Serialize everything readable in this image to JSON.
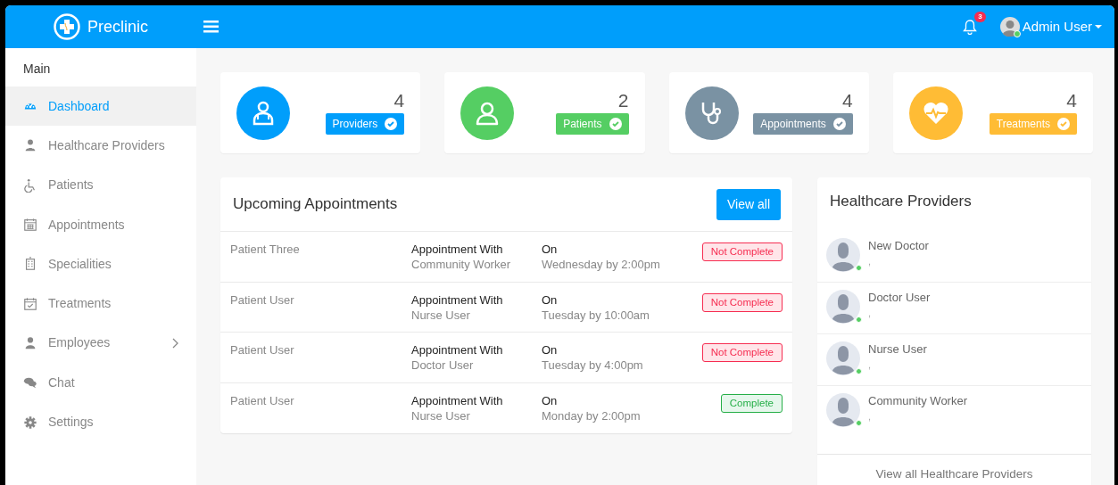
{
  "header": {
    "brand": "Preclinic",
    "notifications": {
      "count": "3"
    },
    "user": {
      "name": "Admin User",
      "online": true
    }
  },
  "sidebar": {
    "heading": "Main",
    "items": [
      {
        "label": "Dashboard",
        "kind": "dashboard",
        "selected": true,
        "submenu": false
      },
      {
        "label": "Healthcare Providers",
        "kind": "doctor",
        "selected": false,
        "submenu": false
      },
      {
        "label": "Patients",
        "kind": "wheelchair",
        "selected": false,
        "submenu": false
      },
      {
        "label": "Appointments",
        "kind": "calendar",
        "selected": false,
        "submenu": false
      },
      {
        "label": "Specialities",
        "kind": "building",
        "selected": false,
        "submenu": false
      },
      {
        "label": "Treatments",
        "kind": "checklist",
        "selected": false,
        "submenu": false
      },
      {
        "label": "Employees",
        "kind": "user",
        "selected": false,
        "submenu": true
      },
      {
        "label": "Chat",
        "kind": "chat",
        "selected": false,
        "submenu": false
      },
      {
        "label": "Settings",
        "kind": "gear",
        "selected": false,
        "submenu": false
      }
    ]
  },
  "stats": [
    {
      "count": "4",
      "label": "Providers",
      "kind": "doctor",
      "color": "#009efb"
    },
    {
      "count": "2",
      "label": "Patients",
      "kind": "user",
      "color": "#55ce63"
    },
    {
      "count": "4",
      "label": "Appointments",
      "kind": "stethoscope",
      "color": "#7a92a3"
    },
    {
      "count": "4",
      "label": "Treatments",
      "kind": "heartbeat",
      "color": "#ffbc35"
    }
  ],
  "appointments": {
    "title": "Upcoming Appointments",
    "button": "View all",
    "rows": [
      {
        "patient": "Patient Three",
        "with_label": "Appointment With",
        "with": "Community Worker",
        "on_label": "On",
        "when": "Wednesday by 2:00pm",
        "status": "Not Complete",
        "complete": false
      },
      {
        "patient": "Patient User",
        "with_label": "Appointment With",
        "with": "Nurse User",
        "on_label": "On",
        "when": "Tuesday by 10:00am",
        "status": "Not Complete",
        "complete": false
      },
      {
        "patient": "Patient User",
        "with_label": "Appointment With",
        "with": "Doctor User",
        "on_label": "On",
        "when": "Tuesday by 4:00pm",
        "status": "Not Complete",
        "complete": false
      },
      {
        "patient": "Patient User",
        "with_label": "Appointment With",
        "with": "Nurse User",
        "on_label": "On",
        "when": "Monday by 2:00pm",
        "status": "Complete",
        "complete": true
      }
    ]
  },
  "providers": {
    "title": "Healthcare Providers",
    "items": [
      {
        "name": "New Doctor",
        "detail": ",",
        "online": true
      },
      {
        "name": "Doctor User",
        "detail": ",",
        "online": true
      },
      {
        "name": "Nurse User",
        "detail": ",",
        "online": true
      },
      {
        "name": "Community Worker",
        "detail": ",",
        "online": true
      }
    ],
    "footer": "View all Healthcare Providers"
  }
}
